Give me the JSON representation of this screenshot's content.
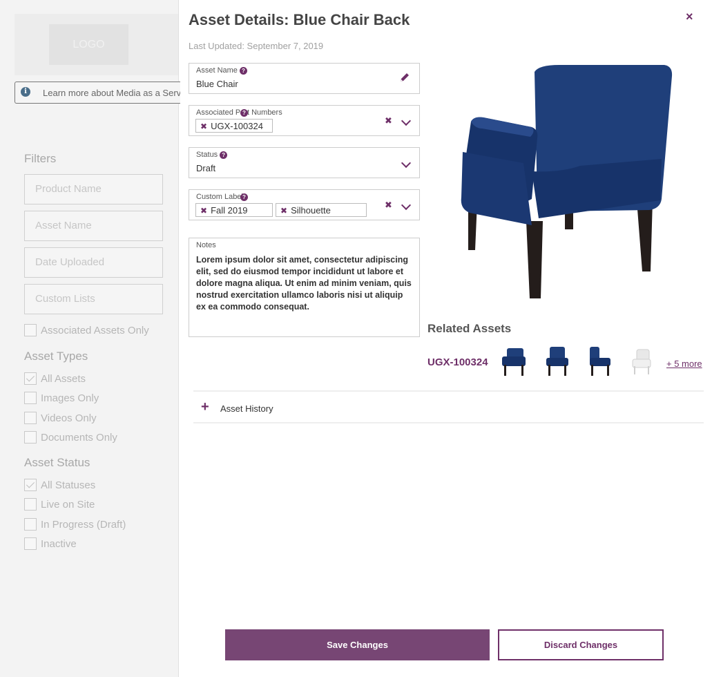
{
  "background": {
    "logo": "LOGO",
    "info_text": "Learn more about Media as a Service",
    "filters_title": "Filters",
    "filter_inputs": [
      "Product Name",
      "Asset Name",
      "Date Uploaded",
      "Custom Lists"
    ],
    "associated_only": "Associated Assets Only",
    "asset_types_title": "Asset Types",
    "asset_types": [
      {
        "label": "All Assets",
        "checked": true
      },
      {
        "label": "Images Only",
        "checked": false
      },
      {
        "label": "Videos Only",
        "checked": false
      },
      {
        "label": "Documents Only",
        "checked": false
      }
    ],
    "asset_status_title": "Asset Status",
    "asset_statuses": [
      {
        "label": "All Statuses",
        "checked": true
      },
      {
        "label": "Live on Site",
        "checked": false
      },
      {
        "label": "In Progress (Draft)",
        "checked": false
      },
      {
        "label": "Inactive",
        "checked": false
      }
    ]
  },
  "modal": {
    "title": "Asset Details: Blue Chair Back",
    "close_icon": "×",
    "last_updated": "Last Updated: September 7, 2019",
    "asset_name": {
      "label": "Asset Name",
      "value": "Blue Chair"
    },
    "part_numbers": {
      "label": "Associated Part Numbers",
      "chips": [
        "UGX-100324"
      ]
    },
    "status": {
      "label": "Status",
      "value": "Draft"
    },
    "custom_labels": {
      "label": "Custom Labels",
      "chips": [
        "Fall 2019",
        "Silhouette"
      ]
    },
    "notes": {
      "label": "Notes",
      "value": "Lorem ipsum dolor sit amet, consectetur adipiscing elit, sed do eiusmod tempor incididunt ut labore et dolore magna aliqua. Ut enim ad minim veniam, quis nostrud exercitation ullamco laboris nisi ut aliquip ex ea commodo consequat."
    },
    "related": {
      "title": "Related Assets",
      "code": "UGX-100324",
      "more": "+ 5 more"
    },
    "history": {
      "label": "Asset History"
    },
    "save": "Save Changes",
    "discard": "Discard Changes"
  },
  "colors": {
    "accent": "#6e2f68",
    "chair": "#1c3b72",
    "legs": "#241d1b"
  }
}
